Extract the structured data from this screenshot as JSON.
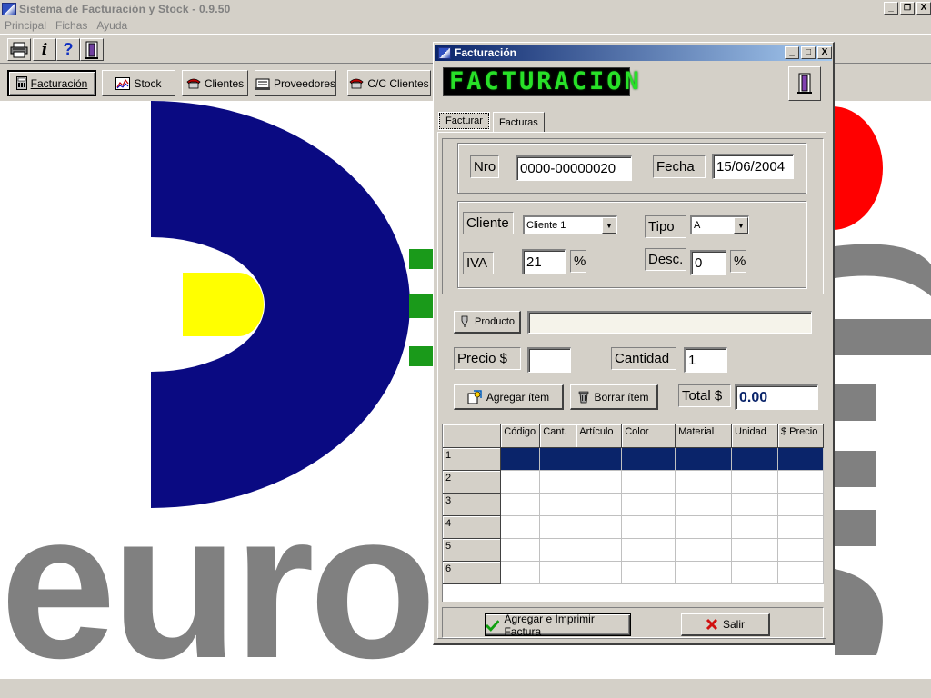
{
  "app": {
    "title": "Sistema de Facturación y Stock  -  0.9.50",
    "window_buttons": [
      "_",
      "🗗",
      "X"
    ]
  },
  "menu": [
    "Principal",
    "Fichas",
    "Ayuda"
  ],
  "toolbar_icons": [
    {
      "icon": "printer-icon",
      "glyph": "🖶"
    },
    {
      "icon": "info-icon",
      "glyph": "i"
    },
    {
      "icon": "help-icon",
      "glyph": "?"
    },
    {
      "icon": "exit-door-icon",
      "glyph": "⌂"
    }
  ],
  "nav_buttons": [
    {
      "label": "Facturación",
      "icon": "calculator-icon",
      "glyph": "▦",
      "active": true
    },
    {
      "label": "Stock",
      "icon": "chart-icon",
      "glyph": "📈"
    },
    {
      "label": "Clientes",
      "icon": "phone-icon",
      "glyph": "☎"
    },
    {
      "label": "Proveedores",
      "icon": "rolodex-icon",
      "glyph": "▤"
    },
    {
      "label": "C/C Clientes",
      "icon": "phone-icon",
      "glyph": "☎"
    }
  ],
  "background_logo_text": "euro",
  "dialog": {
    "title": "Facturación",
    "lcd_text": "FACTURACION",
    "window_buttons": [
      "_",
      "□",
      "X"
    ],
    "tabs": [
      {
        "label": "Facturar",
        "selected": true
      },
      {
        "label": "Facturas",
        "selected": false
      }
    ],
    "nro_label": "Nro",
    "nro_value": "0000-00000020",
    "fecha_label": "Fecha",
    "fecha_value": "15/06/2004",
    "cliente_label": "Cliente",
    "cliente_value": "Cliente 1",
    "tipo_label": "Tipo",
    "tipo_value": "A",
    "iva_label": "IVA",
    "iva_value": "21",
    "iva_unit": "%",
    "desc_label": "Desc.",
    "desc_value": "0",
    "desc_unit": "%",
    "producto_button": "Producto",
    "producto_value": "",
    "precio_label": "Precio $",
    "precio_value": "",
    "cantidad_label": "Cantidad",
    "cantidad_value": "1",
    "agregar_item": "Agregar ítem",
    "borrar_item": "Borrar ítem",
    "total_label": "Total $",
    "total_value": "0.00",
    "grid": {
      "columns": [
        "Código",
        "Cant.",
        "Artículo",
        "Color",
        "Material",
        "Unidad",
        "$ Precio"
      ],
      "rows": [
        "1",
        "2",
        "3",
        "4",
        "5",
        "6"
      ],
      "selected_row": 0,
      "selection_color": "#0a246a"
    },
    "agregar_imprimir": "Agregar e Imprimir Factura",
    "salir": "Salir"
  },
  "colors": {
    "face": "#d4d0c8",
    "title_gradient_start": "#0a246a",
    "title_gradient_end": "#a6caf0",
    "lcd_green": "#28e028",
    "logo_blue": "#0a0a82",
    "logo_yellow": "#ffff00",
    "logo_red": "#ff0000",
    "logo_green": "#1a9a1a",
    "logo_gray": "#808080"
  }
}
